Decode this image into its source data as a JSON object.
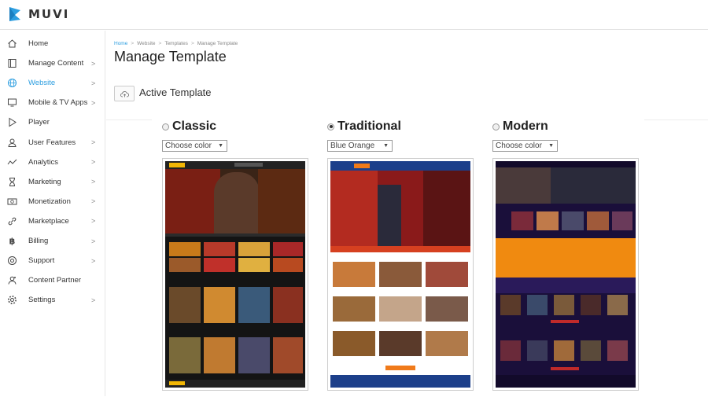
{
  "brand": {
    "name": "MUVI",
    "logo_icon": "muvi-logo-icon",
    "accent": "#2d9ee0"
  },
  "sidebar": {
    "items": [
      {
        "label": "Home",
        "icon": "home-icon",
        "chevron": false,
        "active": false
      },
      {
        "label": "Manage Content",
        "icon": "content-icon",
        "chevron": true,
        "active": false
      },
      {
        "label": "Website",
        "icon": "globe-icon",
        "chevron": true,
        "active": true
      },
      {
        "label": "Mobile & TV Apps",
        "icon": "monitor-icon",
        "chevron": true,
        "active": false
      },
      {
        "label": "Player",
        "icon": "play-icon",
        "chevron": false,
        "active": false
      },
      {
        "label": "User Features",
        "icon": "user-icon",
        "chevron": true,
        "active": false
      },
      {
        "label": "Analytics",
        "icon": "chart-line-icon",
        "chevron": true,
        "active": false
      },
      {
        "label": "Marketing",
        "icon": "hourglass-icon",
        "chevron": true,
        "active": false
      },
      {
        "label": "Monetization",
        "icon": "money-icon",
        "chevron": true,
        "active": false
      },
      {
        "label": "Marketplace",
        "icon": "link-icon",
        "chevron": true,
        "active": false
      },
      {
        "label": "Billing",
        "icon": "bitcoin-icon",
        "chevron": true,
        "active": false
      },
      {
        "label": "Support",
        "icon": "lifebuoy-icon",
        "chevron": true,
        "active": false
      },
      {
        "label": "Content Partner",
        "icon": "partner-icon",
        "chevron": false,
        "active": false
      },
      {
        "label": "Settings",
        "icon": "gear-icon",
        "chevron": true,
        "active": false
      }
    ]
  },
  "breadcrumb": {
    "items": [
      "Home",
      "Website",
      "Templates",
      "Manage Template"
    ]
  },
  "page": {
    "title": "Manage Template",
    "active_template_label": "Active Template"
  },
  "templates": [
    {
      "name": "Classic",
      "selected": false,
      "color_select": "Choose color",
      "preview_icon": "classic-template-preview"
    },
    {
      "name": "Traditional",
      "selected": true,
      "color_select": "Blue Orange",
      "preview_icon": "traditional-template-preview"
    },
    {
      "name": "Modern",
      "selected": false,
      "color_select": "Choose color",
      "preview_icon": "modern-template-preview"
    }
  ]
}
